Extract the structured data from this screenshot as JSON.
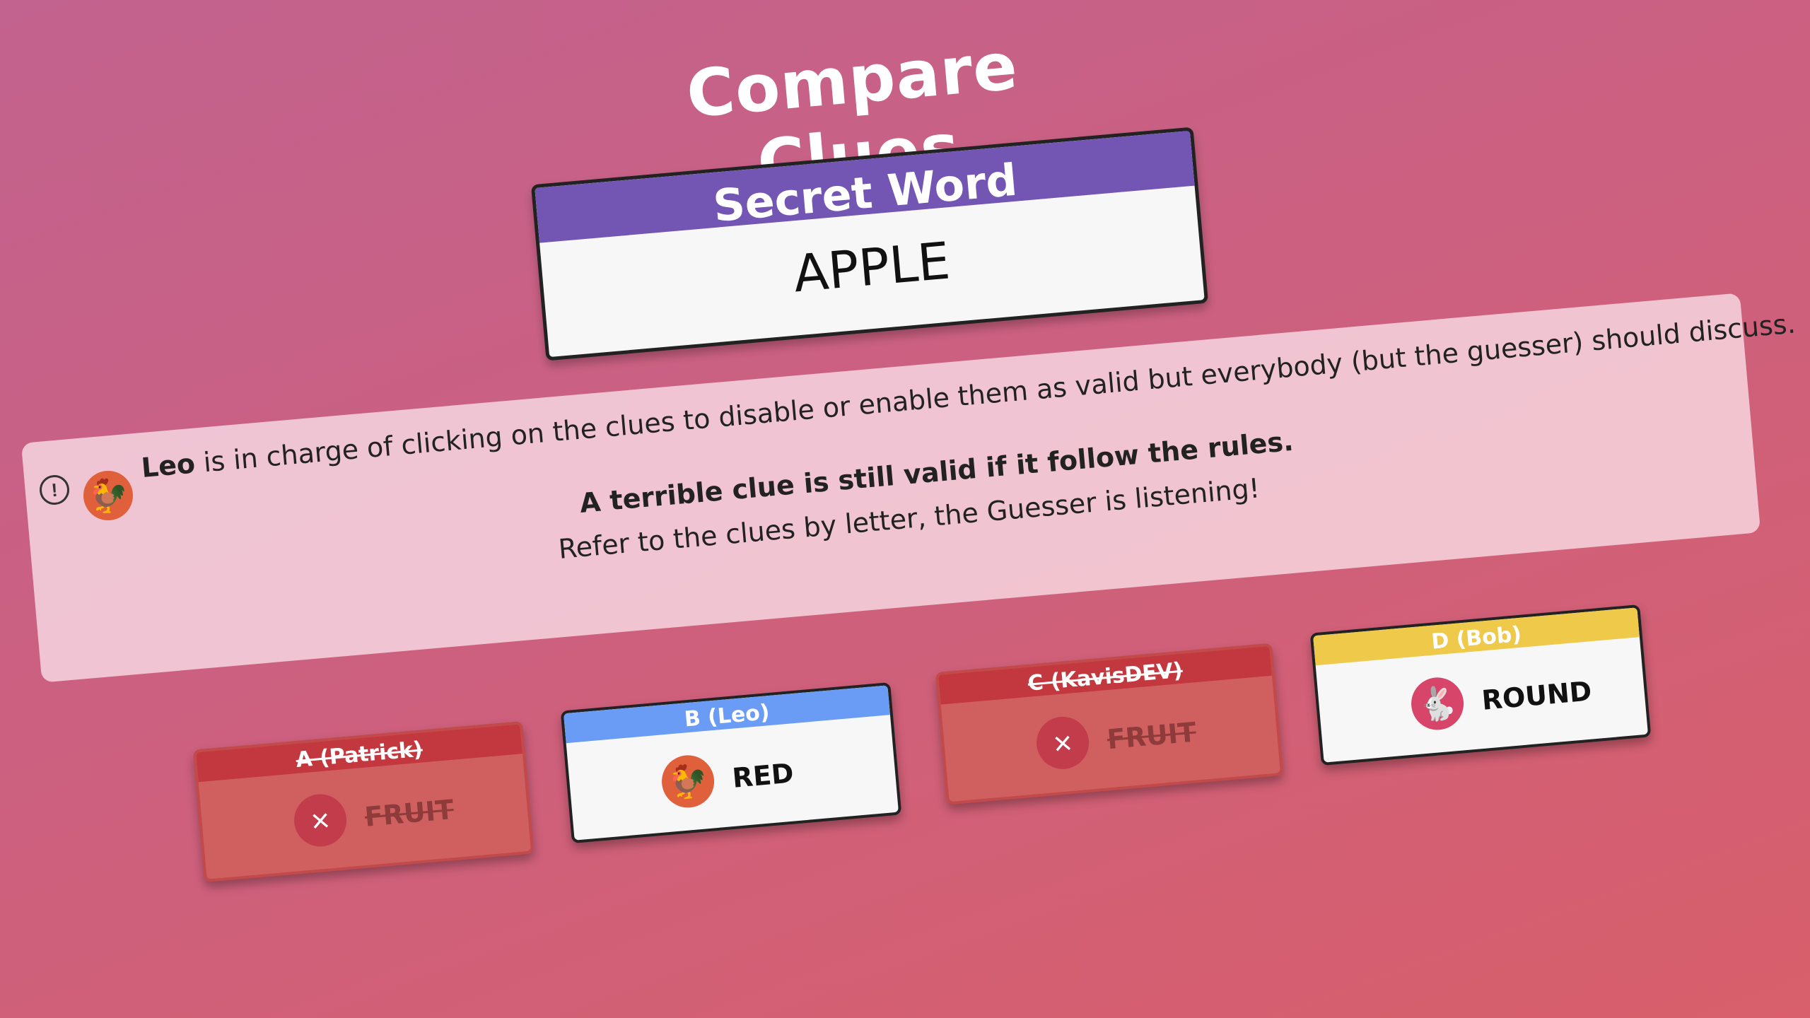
{
  "title": "Compare Clues",
  "secret": {
    "header": "Secret Word",
    "word": "APPLE"
  },
  "info": {
    "icon": "!",
    "leader_name": "Leo",
    "line1_rest": "is in charge of clicking on the clues to disable or enable them as valid but everybody (but the guesser) should discuss.",
    "line2": "A terrible clue is still valid if it follow the rules.",
    "line3": "Refer to the clues by letter, the Guesser is listening!"
  },
  "clues": [
    {
      "header": "A (Patrick)",
      "word": "FRUIT",
      "valid": false,
      "badge_icon": "×",
      "color": "#c2383e"
    },
    {
      "header": "B (Leo)",
      "word": "RED",
      "valid": true,
      "badge_icon": "🐓",
      "color": "#6a9cf5"
    },
    {
      "header": "C (KavisDEV)",
      "word": "FRUIT",
      "valid": false,
      "badge_icon": "×",
      "color": "#4a9a4a"
    },
    {
      "header": "D (Bob)",
      "word": "ROUND",
      "valid": true,
      "badge_icon": "🐇",
      "color": "#efc94a"
    }
  ],
  "avatar_leo": "🐓"
}
